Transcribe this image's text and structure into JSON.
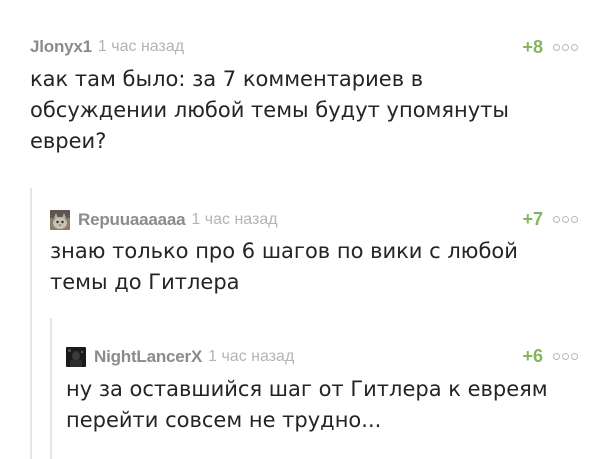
{
  "comments": [
    {
      "author": "Jlonyx1",
      "time": "1 час назад",
      "score": "+8",
      "text": "как там было: за 7 комментариев в\nобсуждении любой темы будут упомянуты\nевреи?",
      "avatar": null
    },
    {
      "author": "Repuuaaaaaa",
      "time": "1 час назад",
      "score": "+7",
      "text": "знаю только про 6 шагов по вики с любой\nтемы до Гитлера",
      "avatar": "cat-avatar"
    },
    {
      "author": "NightLancerX",
      "time": "1 час назад",
      "score": "+6",
      "text": "ну за оставшийся шаг от Гитлера к евреям\nперейти совсем не трудно...",
      "avatar": "dark-figure-avatar"
    }
  ],
  "colors": {
    "author": "#8b8b8b",
    "time": "#b4b4b4",
    "score": "#83b55c",
    "text": "#242424",
    "branch_line": "#e6e6e6"
  },
  "icons": {
    "more": "more-options-icon"
  }
}
